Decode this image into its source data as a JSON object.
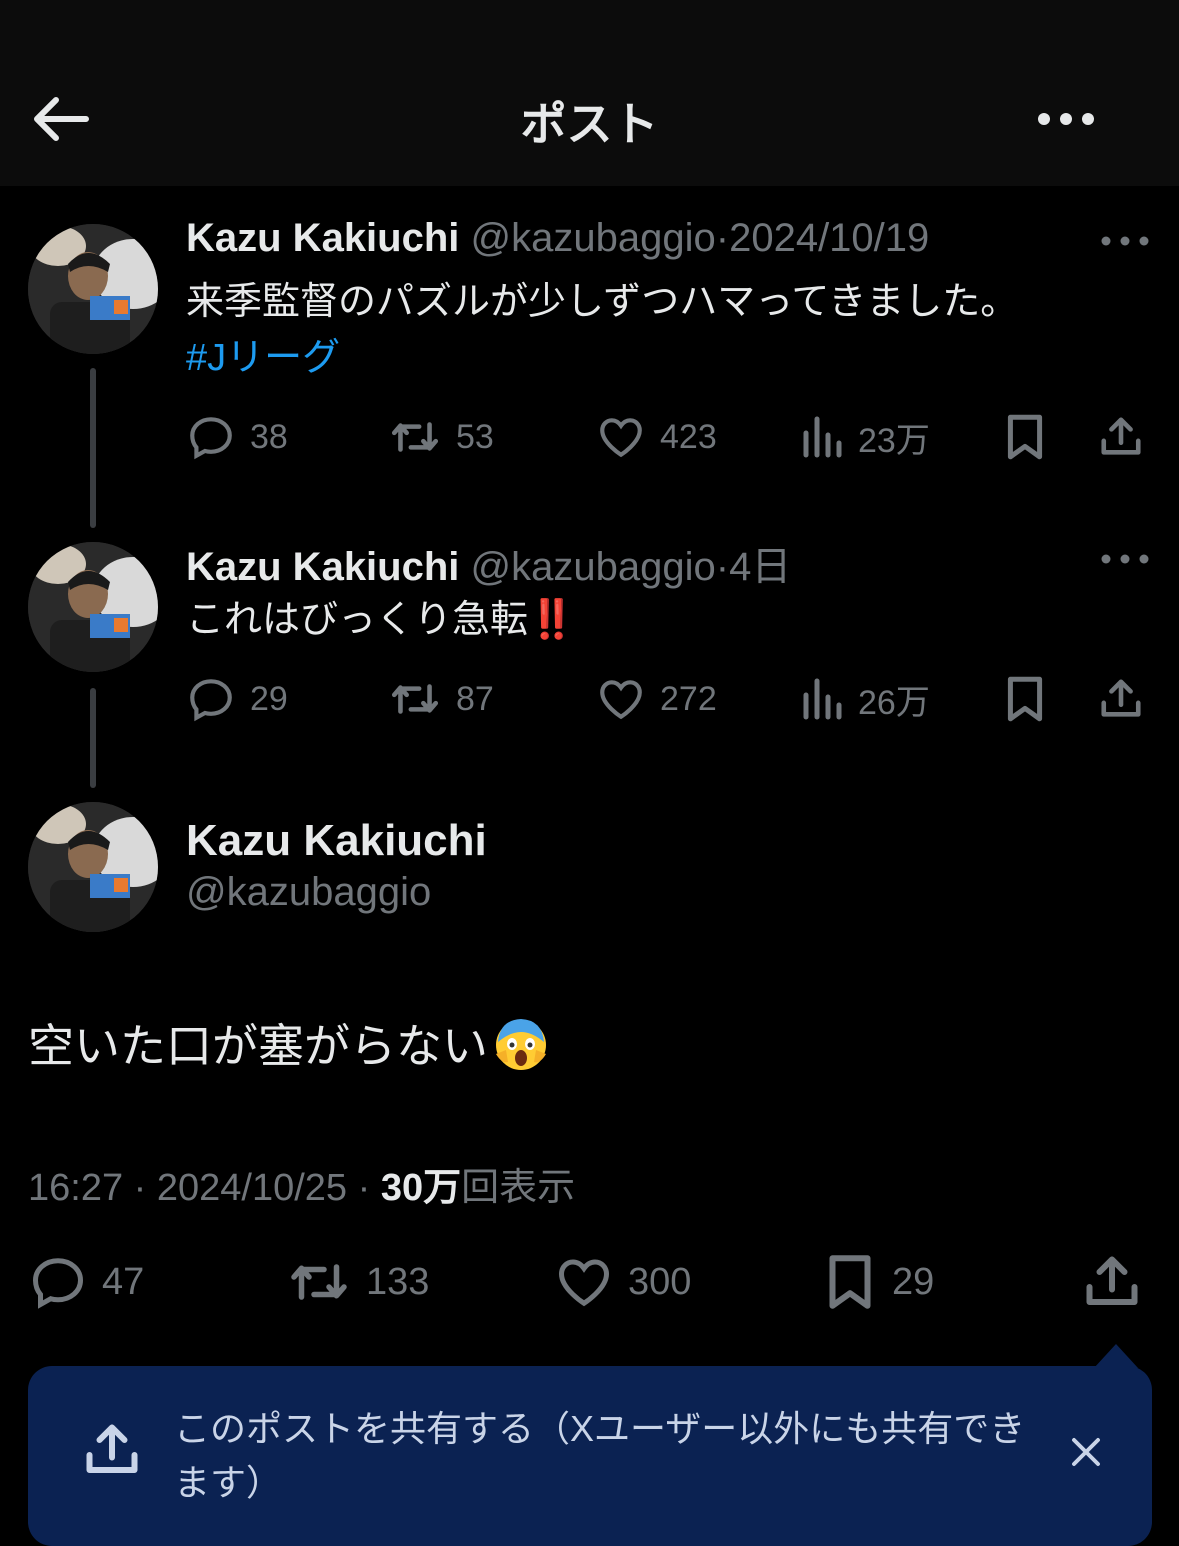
{
  "header": {
    "title": "ポスト",
    "back_icon": "arrow-left-icon",
    "more_icon": "more-horizontal-icon"
  },
  "colors": {
    "background": "#000000",
    "header_bg": "#0c0c0c",
    "text": "#e7e9ea",
    "muted": "#71767b",
    "link": "#1d9bf0",
    "toast_bg": "#0b2252"
  },
  "posts": [
    {
      "name": "Kazu Kakiuchi",
      "handle": "@kazubaggio",
      "sep": "·",
      "time": "2024/10/19",
      "text": "来季監督のパズルが少しずつハマってきました。",
      "hashtag": "#Jリーグ",
      "replies": "38",
      "reposts": "53",
      "likes": "423",
      "views": "23万"
    },
    {
      "name": "Kazu Kakiuchi",
      "handle": "@kazubaggio",
      "sep": "·",
      "time": "4日",
      "text": "これはびっくり急転",
      "emoji": "‼️",
      "replies": "29",
      "reposts": "87",
      "likes": "272",
      "views": "26万"
    }
  ],
  "main": {
    "name": "Kazu Kakiuchi",
    "handle": "@kazubaggio",
    "text": "空いた口が塞がらない",
    "emoji": "😱",
    "time": "16:27",
    "sep": "·",
    "date": "2024/10/25",
    "views_count": "30万",
    "views_label": "回表示",
    "replies": "47",
    "reposts": "133",
    "likes": "300",
    "bookmarks": "29"
  },
  "toast": {
    "text": "このポストを共有する（Xユーザー以外にも共有できます）"
  }
}
